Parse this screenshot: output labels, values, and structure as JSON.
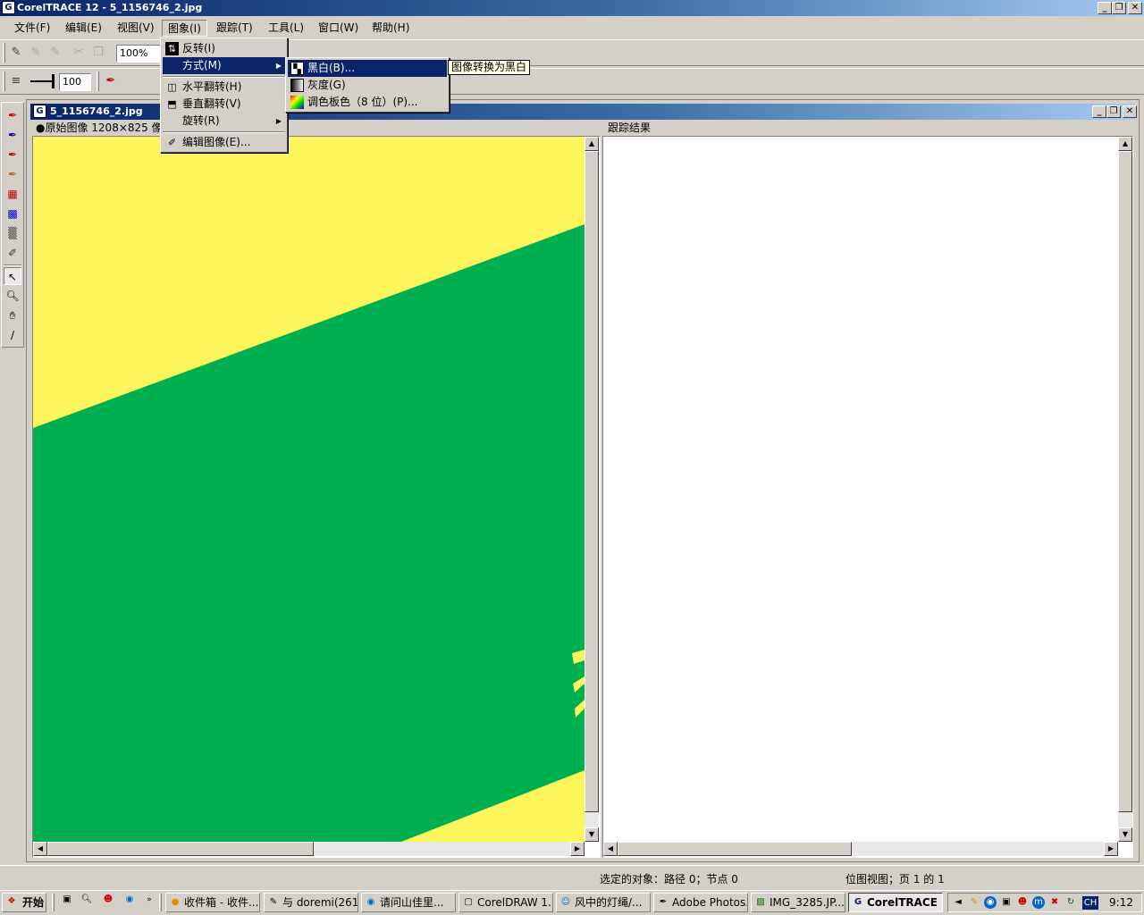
{
  "window": {
    "title": "CorelTRACE 12 - 5_1156746_2.jpg",
    "app_icon": "CorelTRACE-icon",
    "controls": [
      "_",
      "❐",
      "✕"
    ]
  },
  "menubar": [
    "文件(F)",
    "编辑(E)",
    "视图(V)",
    "图象(I)",
    "跟踪(T)",
    "工具(L)",
    "窗口(W)",
    "帮助(H)"
  ],
  "toolbar": {
    "zoom": "100%",
    "smoothing": "100"
  },
  "document": {
    "title": "5_1156746_2.jpg",
    "left_pane_header": "●原始图像   1208×825 像素",
    "right_pane_header": "跟踪结果",
    "image_colors": {
      "yellow": "#fcf65c",
      "green": "#00b050"
    }
  },
  "image_menu": {
    "items": [
      {
        "label": "反转(I)",
        "icon": "invert-icon"
      },
      {
        "label": "方式(M)",
        "icon": "",
        "submenu": true
      },
      {
        "label": "水平翻转(H)",
        "icon": "flip-horizontal-icon"
      },
      {
        "label": "垂直翻转(V)",
        "icon": "flip-vertical-icon"
      },
      {
        "label": "旋转(R)",
        "icon": "",
        "submenu": true
      },
      {
        "label": "编辑图像(E)...",
        "icon": "edit-image-icon"
      }
    ]
  },
  "mode_submenu": {
    "items": [
      {
        "label": "黑白(B)...",
        "icon": "black-white-icon"
      },
      {
        "label": "灰度(G)",
        "icon": "grayscale-icon"
      },
      {
        "label": "调色板色（8 位）(P)...",
        "icon": "palette-icon"
      }
    ]
  },
  "tooltip": "图像转换为黑白",
  "statusbar": {
    "selection": "选定的对象：路径 0；节点 0",
    "view": "位图视图；页 1 的 1"
  },
  "taskbar": {
    "start": "开始",
    "tasks": [
      {
        "label": "收件箱 - 收件...",
        "icon": "mail-icon"
      },
      {
        "label": "与 doremi(261...",
        "icon": "chat-icon"
      },
      {
        "label": "请问山佳里...",
        "icon": "browser-icon"
      },
      {
        "label": "CorelDRAW 1...",
        "icon": "coreldraw-icon"
      },
      {
        "label": "风中的灯绳/...",
        "icon": "people-icon"
      },
      {
        "label": "Adobe Photos...",
        "icon": "photoshop-icon"
      },
      {
        "label": "IMG_3285.JP...",
        "icon": "image-viewer-icon"
      },
      {
        "label": "CorelTRACE 1...",
        "icon": "coreltrace-icon",
        "active": true
      }
    ],
    "language": "CH",
    "clock": "9:12"
  }
}
